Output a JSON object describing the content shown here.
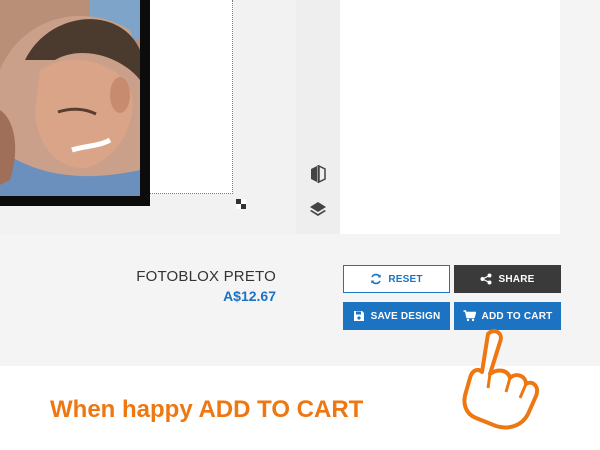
{
  "product": {
    "name": "FOTOBLOX PRETO",
    "price": "A$12.67"
  },
  "actions": {
    "reset_label": "RESET",
    "share_label": "SHARE",
    "save_label": "SAVE DESIGN",
    "cart_label": "ADD TO CART"
  },
  "tools": [
    {
      "icon": "flip-icon"
    },
    {
      "icon": "layers-icon"
    }
  ],
  "instruction": {
    "text": "When happy ADD TO CART"
  },
  "colors": {
    "primary": "#1b73c2",
    "dark_button": "#3a3a3a",
    "accent_orange": "#ee7711",
    "frame": "#0c0c0c"
  }
}
